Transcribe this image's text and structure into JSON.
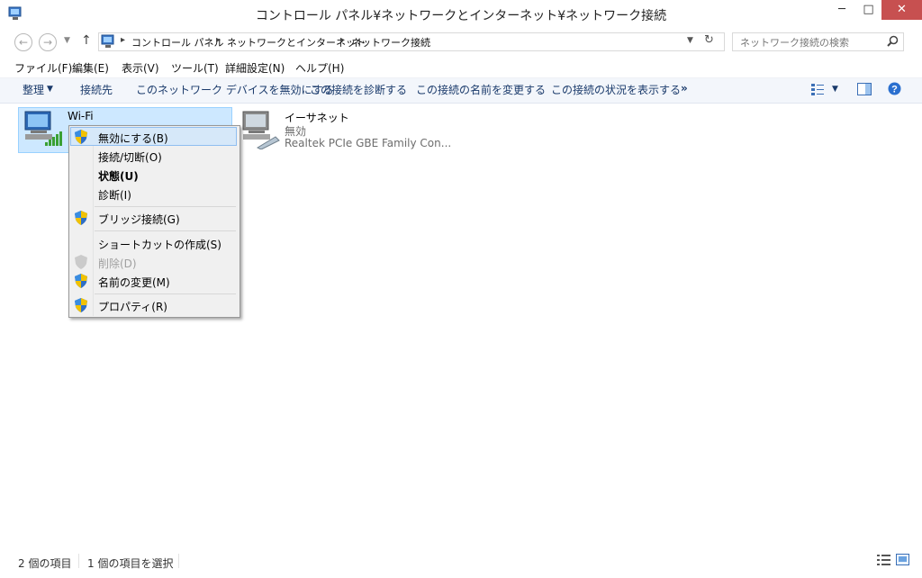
{
  "window": {
    "title": "コントロール パネル¥ネットワークとインターネット¥ネットワーク接続",
    "minimize_glyph": "─",
    "maximize_glyph": "□",
    "close_glyph": "✕"
  },
  "address": {
    "breadcrumbs": [
      "コントロール パネル",
      "ネットワークとインターネット",
      "ネットワーク接続"
    ],
    "search_placeholder": "ネットワーク接続の検索"
  },
  "menu": [
    "ファイル(F)",
    "編集(E)",
    "表示(V)",
    "ツール(T)",
    "詳細設定(N)",
    "ヘルプ(H)"
  ],
  "commands": {
    "organize": "整理",
    "items": [
      "接続先",
      "このネットワーク デバイスを無効にする",
      "この接続を診断する",
      "この接続の名前を変更する",
      "この接続の状況を表示する"
    ],
    "more": "»"
  },
  "connections": [
    {
      "name": "Wi-Fi",
      "status": "",
      "device": ""
    },
    {
      "name": "イーサネット",
      "status": "無効",
      "device": "Realtek PCIe GBE Family Con..."
    }
  ],
  "context_menu": {
    "disable": "無効にする(B)",
    "connect": "接続/切断(O)",
    "status": "状態(U)",
    "diagnose": "診断(I)",
    "bridge": "ブリッジ接続(G)",
    "shortcut": "ショートカットの作成(S)",
    "delete": "削除(D)",
    "rename": "名前の変更(M)",
    "properties": "プロパティ(R)"
  },
  "statusbar": {
    "count": "2 個の項目",
    "selected": "1 個の項目を選択"
  },
  "colors": {
    "close": "#c75050",
    "selection": "#cde8ff",
    "command_text": "#1a3a6b"
  }
}
